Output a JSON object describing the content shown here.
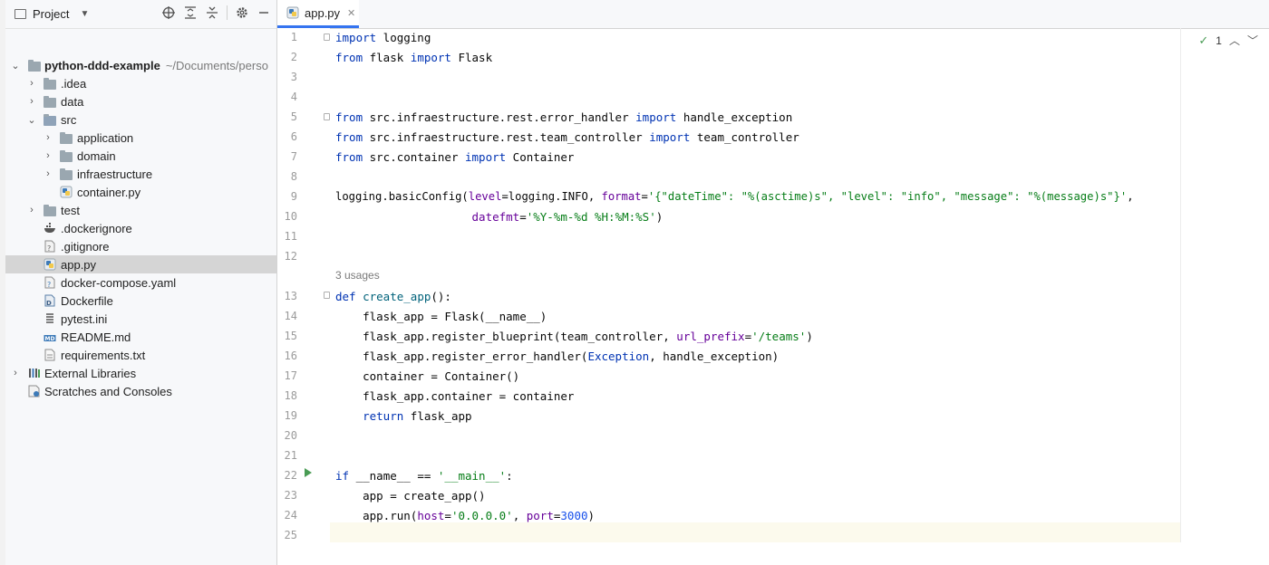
{
  "project_panel": {
    "title": "Project",
    "root_name": "python-ddd-example",
    "root_path": "~/Documents/perso",
    "items": [
      {
        "label": ".idea",
        "kind": "folder"
      },
      {
        "label": "data",
        "kind": "folder"
      },
      {
        "label": "src",
        "kind": "folder"
      },
      {
        "label": "application",
        "kind": "folder"
      },
      {
        "label": "domain",
        "kind": "folder"
      },
      {
        "label": "infraestructure",
        "kind": "folder"
      },
      {
        "label": "container.py",
        "kind": "python-file"
      },
      {
        "label": "test",
        "kind": "folder"
      },
      {
        "label": ".dockerignore",
        "kind": "docker-file"
      },
      {
        "label": ".gitignore",
        "kind": "git-file"
      },
      {
        "label": "app.py",
        "kind": "python-file"
      },
      {
        "label": "docker-compose.yaml",
        "kind": "yaml-file"
      },
      {
        "label": "Dockerfile",
        "kind": "dockerfile"
      },
      {
        "label": "pytest.ini",
        "kind": "ini-file"
      },
      {
        "label": "README.md",
        "kind": "markdown-file"
      },
      {
        "label": "requirements.txt",
        "kind": "text-file"
      },
      {
        "label": "External Libraries",
        "kind": "libraries"
      },
      {
        "label": "Scratches and Consoles",
        "kind": "scratches"
      }
    ],
    "selected": "app.py"
  },
  "editor": {
    "tab_label": "app.py",
    "inspection_count": "1",
    "usages_hint": "3 usages",
    "line_numbers": [
      "1",
      "2",
      "3",
      "4",
      "5",
      "6",
      "7",
      "8",
      "9",
      "10",
      "11",
      "12",
      "13",
      "14",
      "15",
      "16",
      "17",
      "18",
      "19",
      "20",
      "21",
      "22",
      "23",
      "24",
      "25"
    ],
    "lines": {
      "l1_a": "import",
      "l1_b": " logging",
      "l2_a": "from",
      "l2_b": " flask ",
      "l2_c": "import",
      "l2_d": " Flask",
      "l5_a": "from",
      "l5_b": " src.infraestructure.rest.error_handler ",
      "l5_c": "import",
      "l5_d": " handle_exception",
      "l6_a": "from",
      "l6_b": " src.infraestructure.rest.team_controller ",
      "l6_c": "import",
      "l6_d": " team_controller",
      "l7_a": "from",
      "l7_b": " src.container ",
      "l7_c": "import",
      "l7_d": " Container",
      "l9_a": "logging.basicConfig(",
      "l9_b": "level",
      "l9_c": "=logging.INFO, ",
      "l9_d": "format",
      "l9_e": "=",
      "l9_f": "'{\"dateTime\": \"%(asctime)s\", \"level\": \"info\", \"message\": \"%(message)s\"}'",
      "l9_g": ",",
      "l10_a": "                    ",
      "l10_b": "datefmt",
      "l10_c": "=",
      "l10_d": "'%Y-%m-%d %H:%M:%S'",
      "l10_e": ")",
      "l13_a": "def",
      "l13_b": " ",
      "l13_c": "create_app",
      "l13_d": "():",
      "l14": "    flask_app = Flask(__name__)",
      "l15_a": "    flask_app.register_blueprint(team_controller, ",
      "l15_b": "url_prefix",
      "l15_c": "=",
      "l15_d": "'/teams'",
      "l15_e": ")",
      "l16_a": "    flask_app.register_error_handler(",
      "l16_b": "Exception",
      "l16_c": ", handle_exception)",
      "l17": "    container = Container()",
      "l18": "    flask_app.container = container",
      "l19_a": "    ",
      "l19_b": "return",
      "l19_c": " flask_app",
      "l22_a": "if",
      "l22_b": " __name__ == ",
      "l22_c": "'__main__'",
      "l22_d": ":",
      "l23": "    app = create_app()",
      "l24_a": "    app.run(",
      "l24_b": "host",
      "l24_c": "=",
      "l24_d": "'0.0.0.0'",
      "l24_e": ", ",
      "l24_f": "port",
      "l24_g": "=",
      "l24_h": "3000",
      "l24_i": ")"
    }
  },
  "colors": {
    "keyword": "#0033b3",
    "string": "#067d17",
    "number": "#1750eb",
    "parameter": "#660099",
    "function": "#00627a",
    "selection": "#d5d5d5",
    "tab_accent": "#3574f0"
  }
}
